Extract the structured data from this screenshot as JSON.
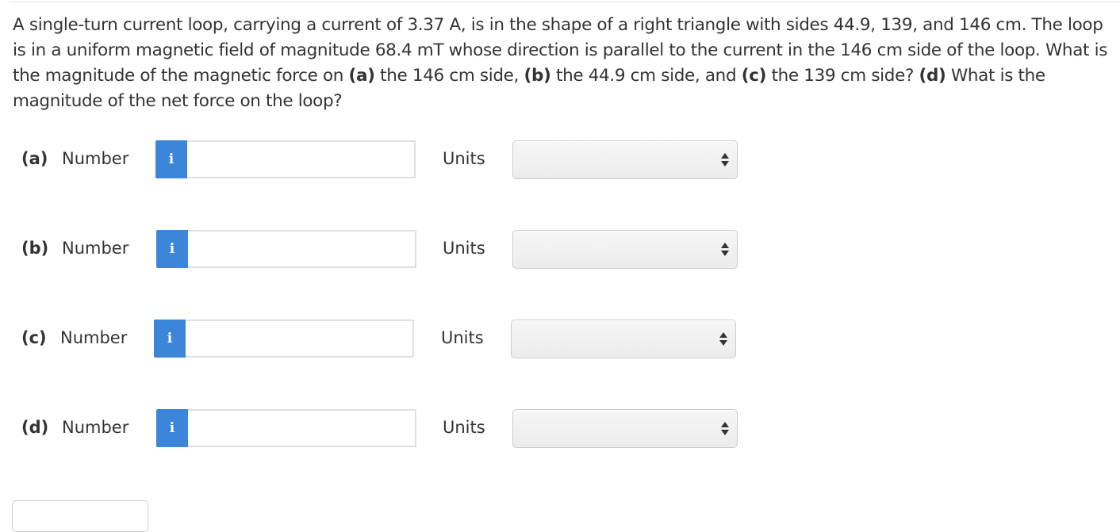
{
  "question": {
    "intro": "A single-turn current loop, carrying a current of 3.37 A, is in the shape of a right triangle with sides 44.9, 139, and 146 cm. The loop is in a uniform magnetic field of magnitude 68.4 mT whose direction is parallel to the current in the 146 cm side of the loop. What is the magnitude of the magnetic force on ",
    "part_a_marker": "(a)",
    "part_a_text": " the 146 cm side, ",
    "part_b_marker": "(b)",
    "part_b_text": " the 44.9 cm side, and ",
    "part_c_marker": "(c)",
    "part_c_text": " the 139 cm side? ",
    "part_d_marker": "(d)",
    "part_d_text": " What is the magnitude of the net force on the loop?"
  },
  "answers": [
    {
      "part": "(a)",
      "number_label": "Number",
      "info_icon": "i",
      "value": "",
      "units_label": "Units",
      "units_selected": ""
    },
    {
      "part": "(b)",
      "number_label": "Number",
      "info_icon": "i",
      "value": "",
      "units_label": "Units",
      "units_selected": ""
    },
    {
      "part": "(c)",
      "number_label": "Number",
      "info_icon": "i",
      "value": "",
      "units_label": "Units",
      "units_selected": ""
    },
    {
      "part": "(d)",
      "number_label": "Number",
      "info_icon": "i",
      "value": "",
      "units_label": "Units",
      "units_selected": ""
    }
  ],
  "colors": {
    "info_button": "#3b86d8",
    "text": "#333333",
    "input_border": "#e0e0e0"
  },
  "icons": {
    "info": "info-icon",
    "select_arrows": "up-down-arrows-icon"
  }
}
